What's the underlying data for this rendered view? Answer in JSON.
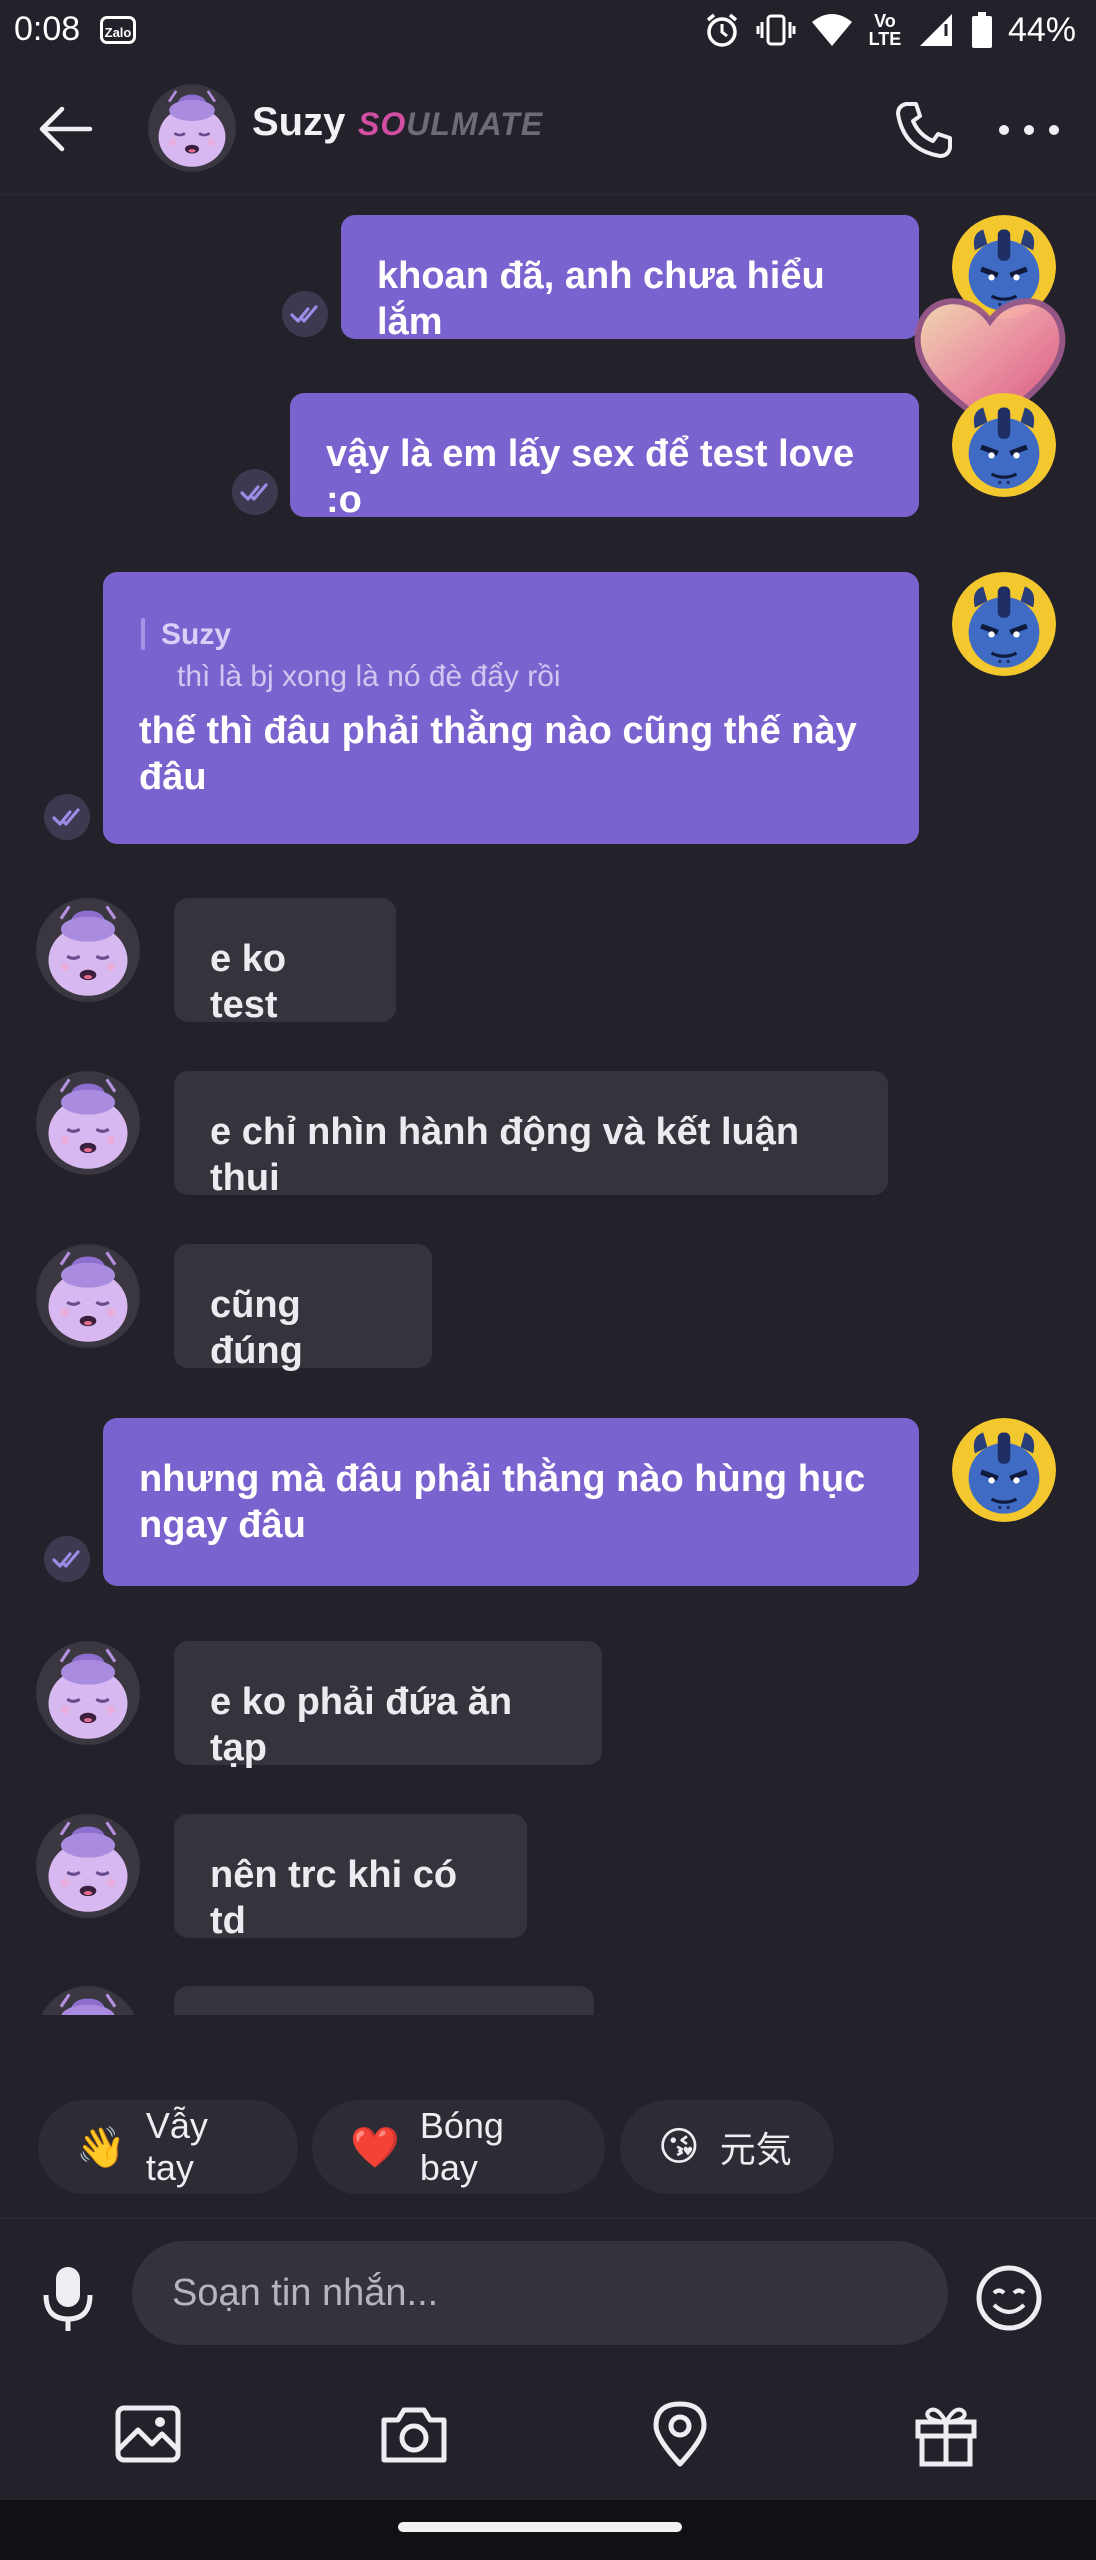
{
  "status_bar": {
    "time": "0:08",
    "app_badge": "Zalo",
    "network": "Vo LTE",
    "battery": "44%"
  },
  "header": {
    "contact_name": "Suzy",
    "tag_pink": "SO",
    "tag_gray": "ULMATE"
  },
  "messages": [
    {
      "dir": "out",
      "text": "khoan đã, anh chưa hiểu lắm"
    },
    {
      "dir": "out",
      "text": "vậy là em lấy sex để test love :o"
    },
    {
      "dir": "out",
      "reply_to_name": "Suzy",
      "reply_to_text": "thì là bj xong là nó đè đẩy rồi",
      "text": "thế thì đâu phải thằng nào cũng thế này đâu"
    },
    {
      "dir": "in",
      "text": "e ko test"
    },
    {
      "dir": "in",
      "text": "e chỉ nhìn hành động và kết luận thui"
    },
    {
      "dir": "in",
      "text": "cũng đúng"
    },
    {
      "dir": "out",
      "text": "nhưng mà đâu phải thằng nào hùng hục ngay đâu"
    },
    {
      "dir": "in",
      "text": "e ko phải đứa ăn tạp"
    },
    {
      "dir": "in",
      "text": "nên trc khi có td"
    }
  ],
  "quick_replies": [
    {
      "emoji": "👋",
      "label": "Vẫy tay"
    },
    {
      "emoji": "❤️",
      "label": "Bóng bay"
    },
    {
      "emoji": "😘",
      "label": "元気"
    }
  ],
  "composer": {
    "placeholder": "Soạn tin nhắn..."
  },
  "colors": {
    "background": "#232129",
    "outgoing_bubble": "#7b63cf",
    "incoming_bubble": "#35333b",
    "brand_pink": "#d04fa3"
  },
  "icons": [
    "back-arrow-icon",
    "phone-icon",
    "more-dots-icon",
    "read-check-icon",
    "mic-icon",
    "emoji-icon",
    "image-icon",
    "camera-icon",
    "location-icon",
    "gift-icon",
    "heart-reaction-icon"
  ]
}
